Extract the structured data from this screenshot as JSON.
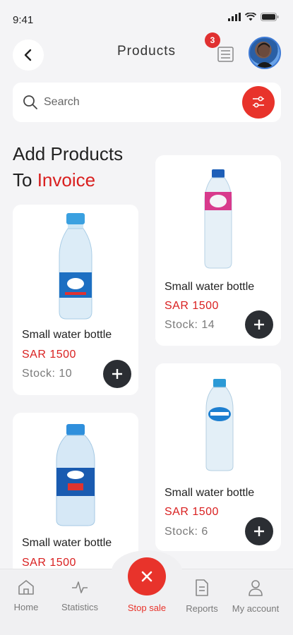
{
  "status_bar": {
    "time": "9:41"
  },
  "header": {
    "title": "Products",
    "invoice_badge_count": "3"
  },
  "search": {
    "placeholder": "Search"
  },
  "section": {
    "heading_line1": "Add Products",
    "heading_line2_prefix": "To",
    "heading_line2_accent": "Invoice"
  },
  "products": [
    {
      "name": "Small water bottle",
      "price": "SAR 1500",
      "stock": "Stock: 10"
    },
    {
      "name": "Small water bottle",
      "price": "SAR 1500",
      "stock": "Stock: 14"
    },
    {
      "name": "Small water bottle",
      "price": "SAR 1500"
    },
    {
      "name": "Small water bottle",
      "price": "SAR 1500",
      "stock": "Stock: 6"
    }
  ],
  "bottom_nav": {
    "home": "Home",
    "statistics": "Statistics",
    "stop_sale": "Stop sale",
    "reports": "Reports",
    "account": "My account"
  },
  "colors": {
    "accent": "#e8332b",
    "dark_button": "#2b2e33",
    "background": "#f4f4f6"
  }
}
